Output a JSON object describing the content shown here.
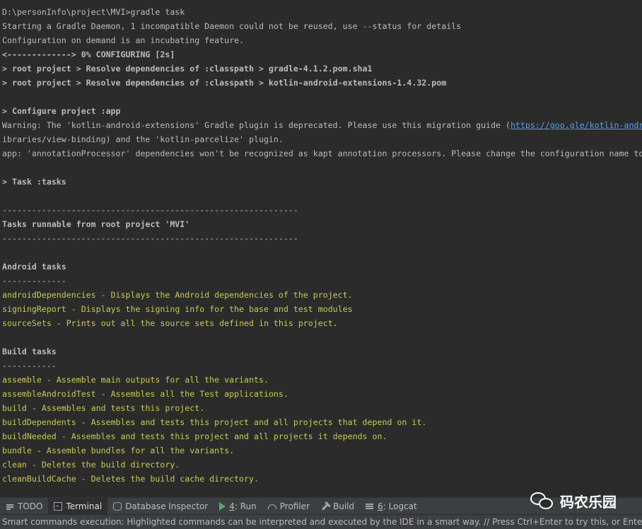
{
  "terminal": {
    "lines": [
      {
        "text": "D:\\personInfo\\project\\MVI>gradle task"
      },
      {
        "text": "Starting a Gradle Daemon, 1 incompatible Daemon could not be reused, use --status for details"
      },
      {
        "text": "Configuration on demand is an incubating feature."
      },
      {
        "text": "<-------------> 0% CONFIGURING [2s]",
        "bold": true
      },
      {
        "text": "> root project > Resolve dependencies of :classpath > gradle-4.1.2.pom.sha1",
        "bold": true
      },
      {
        "text": "> root project > Resolve dependencies of :classpath > kotlin-android-extensions-1.4.32.pom",
        "bold": true
      },
      {
        "text": ""
      },
      {
        "text": "> Configure project :app",
        "bold": true
      },
      {
        "text": "Warning: The 'kotlin-android-extensions' Gradle plugin is deprecated. Please use this migration guide (",
        "link": "https://goo.gle/kotlin-andr"
      },
      {
        "text": "ibraries/view-binding) and the 'kotlin-parcelize' plugin."
      },
      {
        "text": "app: 'annotationProcessor' dependencies won't be recognized as kapt annotation processors. Please change the configuration name to"
      },
      {
        "text": ""
      },
      {
        "text": "> Task :tasks",
        "bold": true
      },
      {
        "text": ""
      },
      {
        "text": "------------------------------------------------------------"
      },
      {
        "text": "Tasks runnable from root project 'MVI'",
        "bold": true
      },
      {
        "text": "------------------------------------------------------------"
      },
      {
        "text": ""
      },
      {
        "text": "Android tasks",
        "bold": true
      },
      {
        "text": "-------------"
      },
      {
        "task": "androidDependencies",
        "desc": "Displays the Android dependencies of the project."
      },
      {
        "task": "signingReport",
        "desc": "Displays the signing info for the base and test modules"
      },
      {
        "task": "sourceSets",
        "desc": "Prints out all the source sets defined in this project."
      },
      {
        "text": ""
      },
      {
        "text": "Build tasks",
        "bold": true
      },
      {
        "text": "-----------"
      },
      {
        "task": "assemble",
        "desc": "Assemble main outputs for all the variants."
      },
      {
        "task": "assembleAndroidTest",
        "desc": "Assembles all the Test applications."
      },
      {
        "task": "build",
        "desc": "Assembles and tests this project."
      },
      {
        "task": "buildDependents",
        "desc": "Assembles and tests this project and all projects that depend on it."
      },
      {
        "task": "buildNeeded",
        "desc": "Assembles and tests this project and all projects it depends on."
      },
      {
        "task": "bundle",
        "desc": "Assemble bundles for all the variants."
      },
      {
        "task": "clean",
        "desc": "Deletes the build directory."
      },
      {
        "task": "cleanBuildCache",
        "desc": "Deletes the build cache directory."
      }
    ],
    "task_separator": " - ",
    "colors": {
      "background": "#2b2b2b",
      "text": "#bbbbbb",
      "task": "#c9c954",
      "link": "#589df6"
    }
  },
  "toolwindows": {
    "todo": {
      "label": "TODO"
    },
    "terminal": {
      "label": "Terminal"
    },
    "database_inspector": {
      "label": "Database Inspector"
    },
    "run": {
      "number": "4",
      "label": ": Run"
    },
    "profiler": {
      "label": "Profiler"
    },
    "build": {
      "label": "Build"
    },
    "logcat": {
      "number": "6",
      "label": ": Logcat"
    }
  },
  "status_bar": {
    "message": "Smart commands execution: Highlighted commands can be interpreted and executed by the IDE in a smart way. // Press Ctrl+Enter to try this, or Enter to ru"
  },
  "watermark": {
    "text": "码农乐园"
  }
}
